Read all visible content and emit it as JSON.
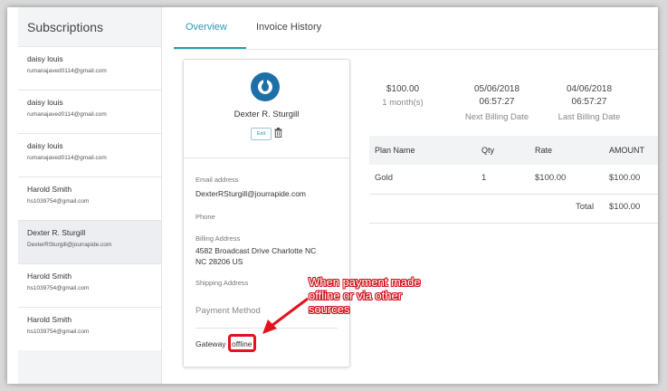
{
  "sidebar": {
    "title": "Subscriptions",
    "items": [
      {
        "name": "daisy louis",
        "email": "rumanajaved0114@gmail.com"
      },
      {
        "name": "daisy louis",
        "email": "rumanajaved0114@gmail.com"
      },
      {
        "name": "daisy louis",
        "email": "rumanajaved0114@gmail.com"
      },
      {
        "name": "Harold Smith",
        "email": "hs1039754@gmail.com"
      },
      {
        "name": "Dexter R. Sturgill",
        "email": "DexterRSturgill@jourrapide.com"
      },
      {
        "name": "Harold Smith",
        "email": "hs1039754@gmail.com"
      },
      {
        "name": "Harold Smith",
        "email": "hs1039754@gmail.com"
      }
    ],
    "selected_index": 4
  },
  "tabs": [
    {
      "label": "Overview",
      "active": true
    },
    {
      "label": "Invoice History",
      "active": false
    }
  ],
  "customer": {
    "name": "Dexter R. Sturgill",
    "edit_label": "Edit",
    "email_label": "Email address",
    "email": "DexterRSturgill@jourrapide.com",
    "phone_label": "Phone",
    "billing_label": "Billing Address",
    "billing_line1": "4582 Broadcast Drive Charlotte NC",
    "billing_line2": "NC 28206 US",
    "shipping_label": "Shipping Address",
    "payment_method_label": "Payment Method",
    "gateway_label": "Gateway",
    "gateway_value": "offline"
  },
  "summary": {
    "amount": "$100.00",
    "period": "1 month(s)",
    "next_date": "05/06/2018",
    "next_time": "06:57:27",
    "next_label": "Next Billing Date",
    "last_date": "04/06/2018",
    "last_time": "06:57:27",
    "last_label": "Last Billing Date"
  },
  "plan_table": {
    "headers": [
      "Plan Name",
      "Qty",
      "Rate",
      "AMOUNT"
    ],
    "rows": [
      {
        "plan": "Gold",
        "qty": "1",
        "rate": "$100.00",
        "amount": "$100.00"
      }
    ],
    "total_label": "Total",
    "total_value": "$100.00"
  },
  "annotation": {
    "line1": "When payment made",
    "line2": "offline or via other",
    "line3": "sources"
  },
  "colors": {
    "accent": "#2a9bb5",
    "annotation_red": "#e3121b",
    "avatar_blue": "#1d6fa8"
  }
}
